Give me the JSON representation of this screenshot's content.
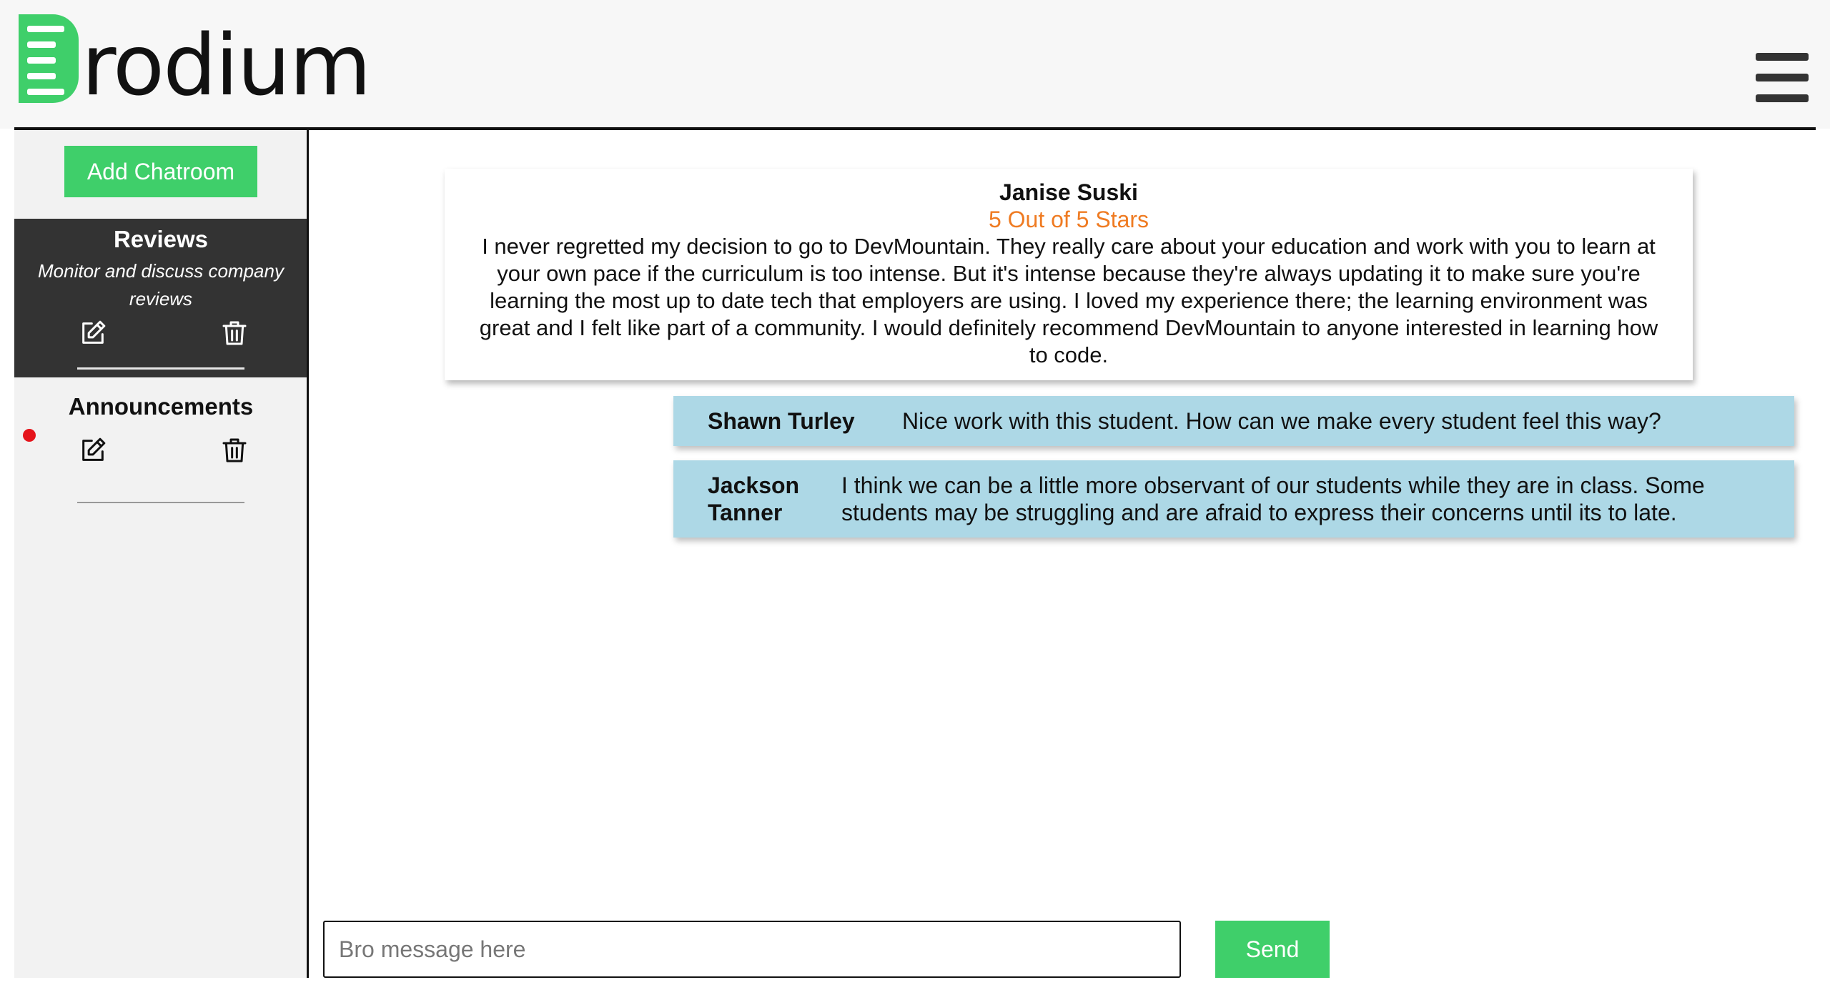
{
  "header": {
    "logo_text": "rodium",
    "logo_initial": "B",
    "brand_color": "#3fcf6a",
    "menu_icon": "hamburger-menu-icon"
  },
  "sidebar": {
    "add_button_label": "Add Chatroom",
    "rooms": [
      {
        "title": "Reviews",
        "description": "Monitor and discuss company reviews",
        "active": true,
        "edit_icon": "edit-icon",
        "delete_icon": "trash-icon"
      },
      {
        "title": "Announcements",
        "description": "",
        "active": false,
        "has_notification": true,
        "edit_icon": "edit-icon",
        "delete_icon": "trash-icon"
      }
    ]
  },
  "chat": {
    "review": {
      "author": "Janise Suski",
      "rating": "5 Out of 5 Stars",
      "rating_color": "#ef7b22",
      "text": "I never regretted my decision to go to DevMountain. They really care about your education and work with you to learn at your own pace if the curriculum is too intense. But it's intense because they're always updating it to make sure you're learning the most up to date tech that employers are using. I loved my experience there; the learning environment was great and I felt like part of a community. I would definitely recommend DevMountain to anyone interested in learning how to code."
    },
    "messages": [
      {
        "author": "Shawn Turley",
        "text": "Nice work with this student. How can we make every student feel this way?"
      },
      {
        "author": "Jackson Tanner",
        "text": "I think we can be a little more observant of our students while they are in class. Some students may be struggling and are afraid to express their concerns until its to late."
      }
    ],
    "bubble_color": "#add8e6"
  },
  "composer": {
    "placeholder": "Bro message here",
    "value": "",
    "send_label": "Send"
  }
}
